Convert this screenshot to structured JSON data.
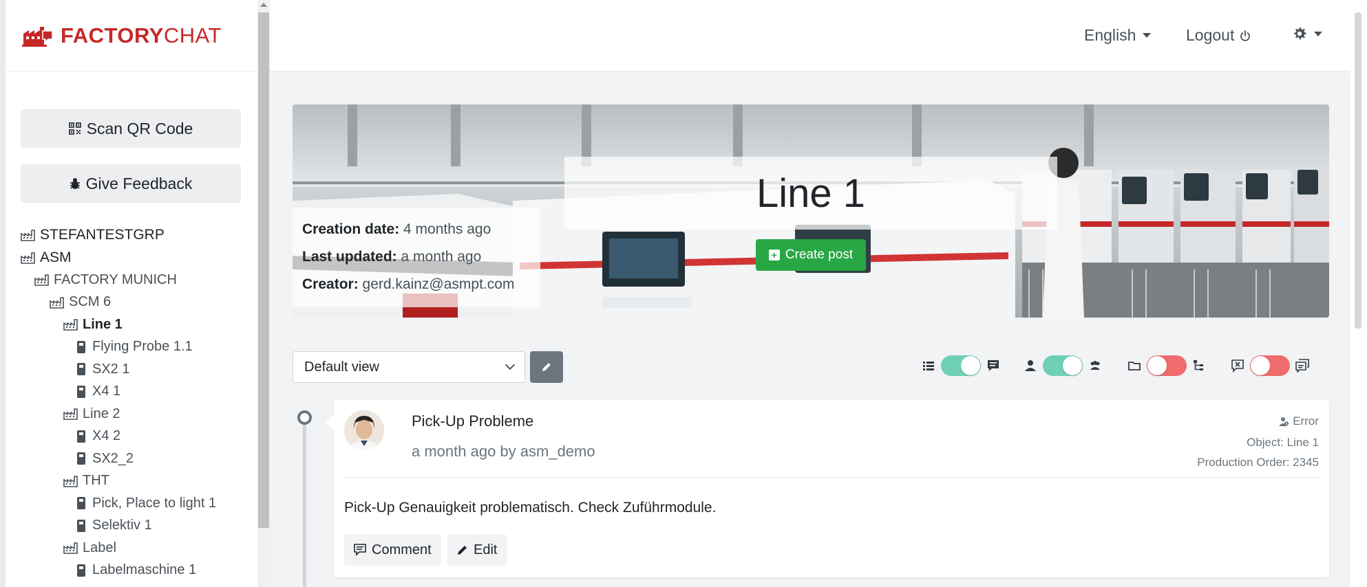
{
  "brand": {
    "name_bold": "FACTORY",
    "name_light": "CHAT"
  },
  "sidebar": {
    "scan_label": "Scan QR Code",
    "feedback_label": "Give Feedback",
    "tree": [
      {
        "label": "STEFANTESTGRP",
        "level": 0,
        "type": "factory"
      },
      {
        "label": "ASM",
        "level": 0,
        "type": "factory"
      },
      {
        "label": "FACTORY MUNICH",
        "level": 1,
        "type": "factory"
      },
      {
        "label": "SCM 6",
        "level": 2,
        "type": "factory"
      },
      {
        "label": "Line 1",
        "level": 3,
        "type": "factory",
        "active": true
      },
      {
        "label": "Flying Probe 1.1",
        "level": 4,
        "type": "device"
      },
      {
        "label": "SX2 1",
        "level": 4,
        "type": "device"
      },
      {
        "label": "X4 1",
        "level": 4,
        "type": "device"
      },
      {
        "label": "Line 2",
        "level": 3,
        "type": "factory"
      },
      {
        "label": "X4 2",
        "level": 4,
        "type": "device"
      },
      {
        "label": "SX2_2",
        "level": 4,
        "type": "device"
      },
      {
        "label": "THT",
        "level": 3,
        "type": "factory"
      },
      {
        "label": "Pick, Place to light 1",
        "level": 4,
        "type": "device"
      },
      {
        "label": "Selektiv 1",
        "level": 4,
        "type": "device"
      },
      {
        "label": "Label",
        "level": 3,
        "type": "factory"
      },
      {
        "label": "Labelmaschine 1",
        "level": 4,
        "type": "device"
      }
    ]
  },
  "topbar": {
    "language": "English",
    "logout": "Logout"
  },
  "hero": {
    "title": "Line 1",
    "creation_label": "Creation date:",
    "creation_value": "4 months ago",
    "updated_label": "Last updated:",
    "updated_value": "a month ago",
    "creator_label": "Creator:",
    "creator_value": "gerd.kainz@asmpt.com",
    "create_post_label": "Create post"
  },
  "controls": {
    "view_selected": "Default view",
    "toggles": [
      {
        "left_icon": "list-icon",
        "right_icon": "message-icon",
        "state": "on"
      },
      {
        "left_icon": "user-icon",
        "right_icon": "users-icon",
        "state": "on"
      },
      {
        "left_icon": "folder-icon",
        "right_icon": "hierarchy-icon",
        "state": "off"
      },
      {
        "left_icon": "close-box-icon",
        "right_icon": "messages-icon",
        "state": "off"
      }
    ]
  },
  "post": {
    "title": "Pick-Up Probleme",
    "meta": "a month ago by asm_demo",
    "type": "Error",
    "object": "Object: Line 1",
    "production_order": "Production Order: 2345",
    "body": "Pick-Up Genauigkeit problematisch. Check Zuführmodule.",
    "comment_label": "Comment",
    "edit_label": "Edit"
  },
  "colors": {
    "brand": "#c62828",
    "success": "#28a745",
    "toggle_on": "#6fd0b6",
    "toggle_off": "#f06b6b"
  }
}
